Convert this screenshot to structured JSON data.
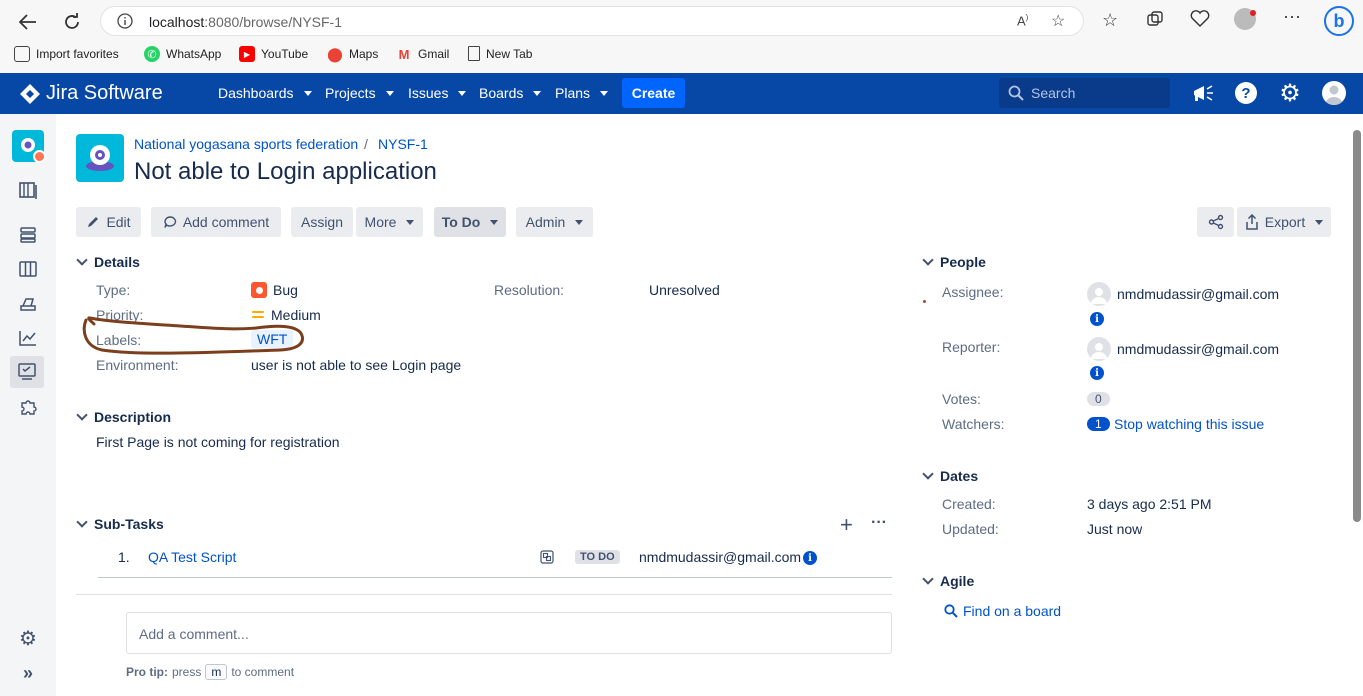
{
  "browser": {
    "url_host": "localhost",
    "url_path": ":8080/browse/NYSF-1",
    "bookmarks": [
      "Import favorites",
      "WhatsApp",
      "YouTube",
      "Maps",
      "Gmail",
      "New Tab"
    ]
  },
  "nav": {
    "logo": "Jira Software",
    "menus": [
      "Dashboards",
      "Projects",
      "Issues",
      "Boards",
      "Plans"
    ],
    "create": "Create",
    "search_placeholder": "Search"
  },
  "breadcrumb": {
    "project": "National yogasana sports federation",
    "separator": "/",
    "issue_key": "NYSF-1"
  },
  "issue": {
    "title": "Not able to Login application"
  },
  "toolbar": {
    "edit": "Edit",
    "add_comment": "Add comment",
    "assign": "Assign",
    "more": "More",
    "status": "To Do",
    "admin": "Admin",
    "export": "Export"
  },
  "details": {
    "heading": "Details",
    "type_label": "Type:",
    "type_value": "Bug",
    "priority_label": "Priority:",
    "priority_value": "Medium",
    "labels_label": "Labels:",
    "labels_value": "WFT",
    "environment_label": "Environment:",
    "environment_value": "user is not able to see Login page",
    "resolution_label": "Resolution:",
    "resolution_value": "Unresolved"
  },
  "description": {
    "heading": "Description",
    "text": "First Page is not coming for registration"
  },
  "subtasks": {
    "heading": "Sub-Tasks",
    "rows": [
      {
        "num": "1.",
        "title": "QA Test Script",
        "status": "TO DO",
        "assignee": "nmdmudassir@gmail.com"
      }
    ]
  },
  "comment": {
    "placeholder": "Add a comment...",
    "protip_bold": "Pro tip:",
    "protip_press": "press",
    "protip_key": "m",
    "protip_rest": "to comment"
  },
  "people": {
    "heading": "People",
    "assignee_label": "Assignee:",
    "assignee_value": "nmdmudassir@gmail.com",
    "reporter_label": "Reporter:",
    "reporter_value": "nmdmudassir@gmail.com",
    "votes_label": "Votes:",
    "votes_value": "0",
    "watchers_label": "Watchers:",
    "watchers_count": "1",
    "watchers_link": "Stop watching this issue"
  },
  "dates": {
    "heading": "Dates",
    "created_label": "Created:",
    "created_value": "3 days ago 2:51 PM",
    "updated_label": "Updated:",
    "updated_value": "Just now"
  },
  "agile": {
    "heading": "Agile",
    "link": "Find on a board"
  },
  "colors": {
    "nav_bg": "#0747a6",
    "create_bg": "#0065ff",
    "link": "#0052cc",
    "annotation": "#7b3f1e"
  }
}
